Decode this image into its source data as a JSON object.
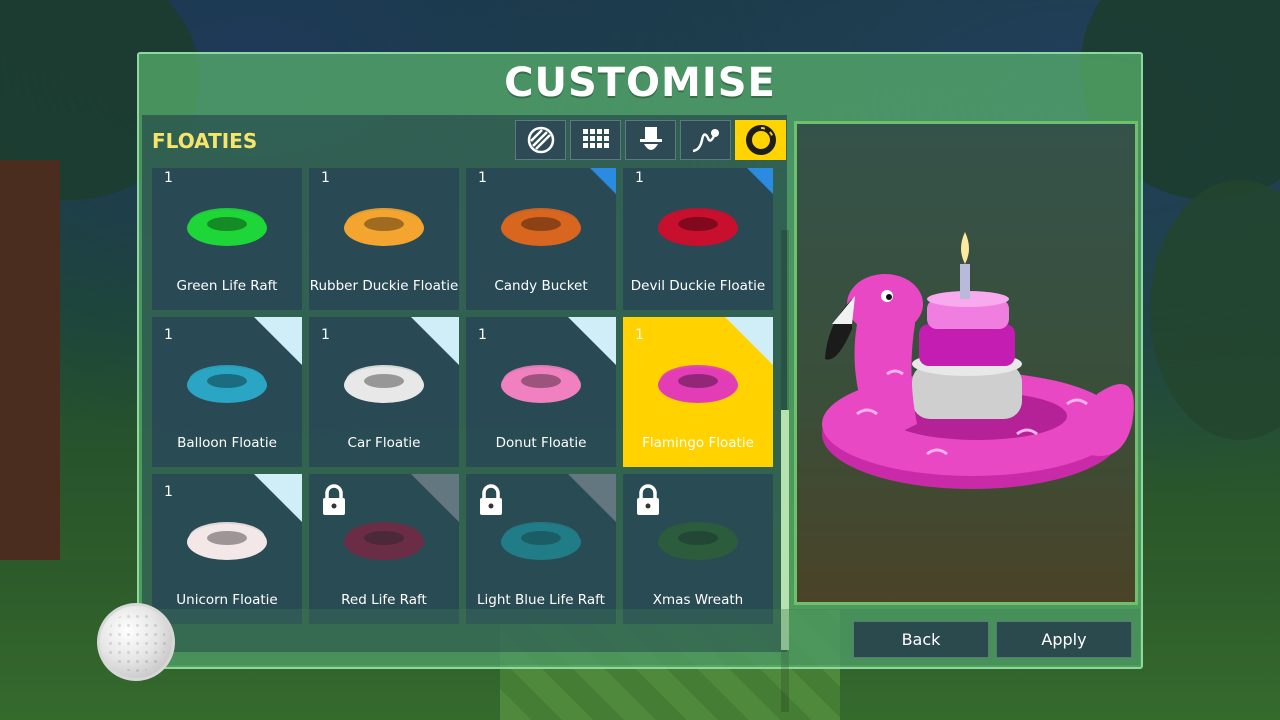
{
  "title": "CUSTOMISE",
  "section_title": "FLOATIES",
  "tabs": [
    {
      "icon": "ball-pattern-icon",
      "active": false
    },
    {
      "icon": "grid-pattern-icon",
      "active": false
    },
    {
      "icon": "top-hat-icon",
      "active": false
    },
    {
      "icon": "trail-icon",
      "active": false
    },
    {
      "icon": "life-ring-icon",
      "active": true
    }
  ],
  "items": [
    {
      "name": "Green Life Raft",
      "qty": "1",
      "corner": "none",
      "locked": false,
      "selected": false,
      "color": "#1fd63a"
    },
    {
      "name": "Rubber Duckie Floatie",
      "qty": "1",
      "corner": "none",
      "locked": false,
      "selected": false,
      "color": "#f4a531"
    },
    {
      "name": "Candy Bucket",
      "qty": "1",
      "corner": "blue",
      "locked": false,
      "selected": false,
      "color": "#d8661f"
    },
    {
      "name": "Devil Duckie Floatie",
      "qty": "1",
      "corner": "blue",
      "locked": false,
      "selected": false,
      "color": "#c8102e"
    },
    {
      "name": "Balloon Floatie",
      "qty": "1",
      "corner": "light",
      "locked": false,
      "selected": false,
      "color": "#2aa6c4"
    },
    {
      "name": "Car Floatie",
      "qty": "1",
      "corner": "light",
      "locked": false,
      "selected": false,
      "color": "#e8e8e8"
    },
    {
      "name": "Donut Floatie",
      "qty": "1",
      "corner": "light",
      "locked": false,
      "selected": false,
      "color": "#f080c0"
    },
    {
      "name": "Flamingo Floatie",
      "qty": "1",
      "corner": "light",
      "locked": false,
      "selected": true,
      "color": "#e23db7"
    },
    {
      "name": "Unicorn Floatie",
      "qty": "1",
      "corner": "light",
      "locked": false,
      "selected": false,
      "color": "#f3e7e7"
    },
    {
      "name": "Red Life Raft",
      "qty": "",
      "corner": "grey",
      "locked": true,
      "selected": false,
      "color": "#a0163a"
    },
    {
      "name": "Light Blue Life Raft",
      "qty": "",
      "corner": "grey",
      "locked": true,
      "selected": false,
      "color": "#1aa6b2"
    },
    {
      "name": "Xmas Wreath",
      "qty": "",
      "corner": "none",
      "locked": true,
      "selected": false,
      "color": "#2f6a2a"
    }
  ],
  "buttons": {
    "back": "Back",
    "apply": "Apply"
  },
  "colors": {
    "accent": "#ffd200",
    "title": "#f6e46b",
    "panel": "#5ab46e"
  }
}
